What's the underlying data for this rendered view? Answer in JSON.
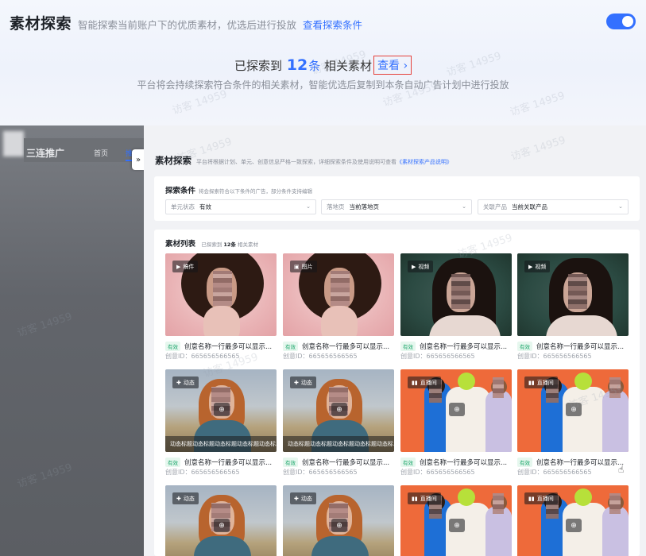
{
  "header": {
    "title": "素材探索",
    "subtitle": "智能探索当前账户下的优质素材，优选后进行投放",
    "condition_link": "查看探索条件",
    "toggle_on": true
  },
  "found": {
    "prefix": "已探索到",
    "count": "12",
    "unit": "条",
    "suffix": "相关素材",
    "view_button": "查看 ›"
  },
  "description": "平台将会持续探索符合条件的相关素材，智能优选后复制到本条自动广告计划中进行投放",
  "watermark_text": "访客 14959",
  "embedded": {
    "left_nav": {
      "logo": "三连推广",
      "home": "首页",
      "active": "推"
    },
    "collapse_icon": "»",
    "panel_title": "素材探索",
    "panel_desc": "平台将根据计划、单元、创意信息严格一致探索，详细探索条件及使用说明可查看",
    "panel_link": "《素材探索产品说明》",
    "conditions": {
      "title": "探索条件",
      "hint": "将会探索符合以下条件的广告，部分条件支持编辑",
      "selects": [
        {
          "label": "单元状态",
          "value": "有效"
        },
        {
          "label": "落地页",
          "value": "当前落地页"
        },
        {
          "label": "关联产品",
          "value": "当前关联产品"
        }
      ]
    },
    "list": {
      "title": "素材列表",
      "sub_prefix": "已探索到",
      "sub_count": "12条",
      "sub_suffix": "相关素材"
    },
    "tiles": [
      {
        "type": "稿件",
        "icon": "▶",
        "kind": "pink",
        "status": "有效",
        "name": "创意名称一行最多可以显示...",
        "id": "创意ID：665656566565"
      },
      {
        "type": "图片",
        "icon": "▣",
        "kind": "pink",
        "status": "有效",
        "name": "创意名称一行最多可以显示...",
        "id": "创意ID：665656566565"
      },
      {
        "type": "视频",
        "icon": "▶",
        "kind": "teal",
        "status": "有效",
        "name": "创意名称一行最多可以显示...",
        "id": "创意ID：665656566565"
      },
      {
        "type": "视频",
        "icon": "▶",
        "kind": "teal",
        "status": "有效",
        "name": "创意名称一行最多可以显示...",
        "id": "创意ID：665656566565"
      },
      {
        "type": "动态",
        "icon": "✚",
        "kind": "field",
        "status": "有效",
        "name": "创意名称一行最多可以显示...",
        "id": "创意ID：665656566565",
        "caption": "动态标题动态标题动态标题动态标题动态标..."
      },
      {
        "type": "动态",
        "icon": "✚",
        "kind": "field",
        "status": "有效",
        "name": "创意名称一行最多可以显示...",
        "id": "创意ID：665656566565",
        "caption": "动态标题动态标题动态标题动态标题动态标..."
      },
      {
        "type": "直播间",
        "icon": "▮▮",
        "kind": "orange",
        "status": "有效",
        "name": "创意名称一行最多可以显示...",
        "id": "创意ID：665656566565"
      },
      {
        "type": "直播间",
        "icon": "▮▮",
        "kind": "orange",
        "status": "有效",
        "name": "创意名称一行最多可以显示...",
        "id": "创意ID：665656566565"
      },
      {
        "type": "动态",
        "icon": "✚",
        "kind": "field"
      },
      {
        "type": "动态",
        "icon": "✚",
        "kind": "field"
      },
      {
        "type": "直播间",
        "icon": "▮▮",
        "kind": "orange"
      },
      {
        "type": "直播间",
        "icon": "▮▮",
        "kind": "orange"
      }
    ]
  },
  "colors": {
    "accent": "#3370ff",
    "alert_border": "#e5413b",
    "valid_green": "#1aa66a"
  }
}
